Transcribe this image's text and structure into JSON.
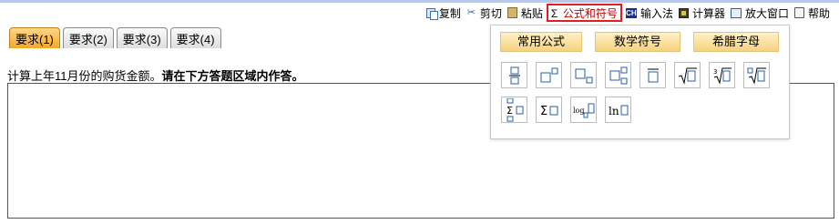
{
  "toolbar": {
    "items": [
      {
        "label": "复制",
        "icon": "copy-icon"
      },
      {
        "label": "剪切",
        "icon": "cut-icon"
      },
      {
        "label": "粘贴",
        "icon": "paste-icon"
      },
      {
        "label": "公式和符号",
        "icon": "sigma-icon",
        "active": true,
        "sigma_glyph": "Σ"
      },
      {
        "label": "输入法",
        "icon": "ime-icon",
        "badge": "CH"
      },
      {
        "label": "计算器",
        "icon": "calculator-icon"
      },
      {
        "label": "放大窗口",
        "icon": "enlarge-window-icon"
      },
      {
        "label": "帮助",
        "icon": "help-icon"
      }
    ],
    "active_border_color": "#e02020"
  },
  "tabs": [
    {
      "label": "要求(1)",
      "active": true
    },
    {
      "label": "要求(2)",
      "active": false
    },
    {
      "label": "要求(3)",
      "active": false
    },
    {
      "label": "要求(4)",
      "active": false
    }
  ],
  "question": {
    "text": "计算上年11月份的购货金额。",
    "instruction": "请在下方答题区域内作答。"
  },
  "formula_popup": {
    "tabs": [
      "常用公式",
      "数学符号",
      "希腊字母"
    ],
    "symbols": [
      {
        "name": "fraction",
        "label": ""
      },
      {
        "name": "superscript",
        "label": ""
      },
      {
        "name": "subscript",
        "label": ""
      },
      {
        "name": "sub-superscript",
        "label": ""
      },
      {
        "name": "overline",
        "label": ""
      },
      {
        "name": "square-root",
        "label": ""
      },
      {
        "name": "cube-root",
        "label": "3"
      },
      {
        "name": "nth-root",
        "label": "n"
      },
      {
        "name": "summation-limits",
        "label": "Σ"
      },
      {
        "name": "summation",
        "label": "Σ"
      },
      {
        "name": "logarithm",
        "label": "log"
      },
      {
        "name": "natural-log",
        "label": "ln"
      }
    ]
  },
  "colors": {
    "tab_active": "#f5a623",
    "popup_tab": "#f6d27e",
    "topline": "#b8c8e8"
  }
}
